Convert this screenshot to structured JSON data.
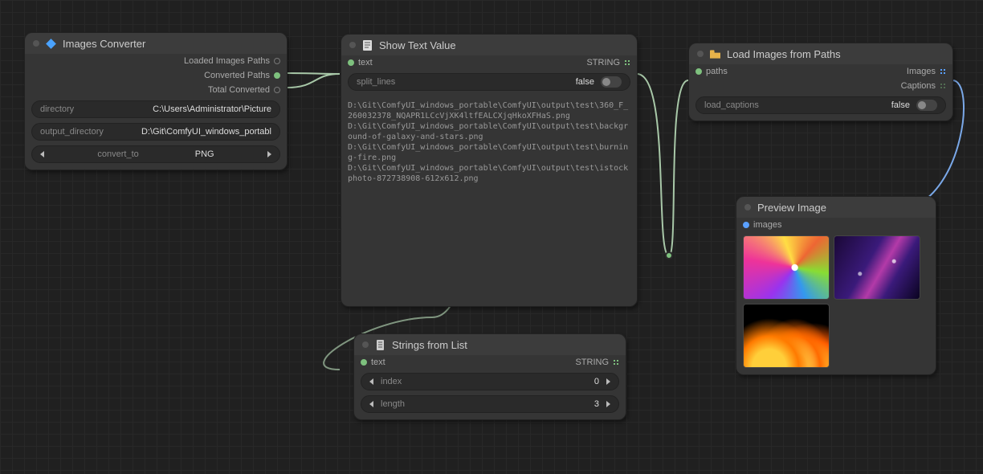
{
  "nodes": {
    "converter": {
      "title": "Images Converter",
      "outputs": {
        "loaded": "Loaded Images Paths",
        "converted": "Converted Paths",
        "total": "Total Converted"
      },
      "widgets": {
        "directory_label": "directory",
        "directory_value": "C:\\Users\\Administrator\\Picture",
        "output_dir_label": "output_directory",
        "output_dir_value": "D:\\Git\\ComfyUI_windows_portabl",
        "convert_to_label": "convert_to",
        "convert_to_value": "PNG"
      }
    },
    "showtext": {
      "title": "Show Text Value",
      "input": "text",
      "output_type": "STRING",
      "widgets": {
        "split_lines_label": "split_lines",
        "split_lines_value": "false"
      },
      "text_body": "D:\\Git\\ComfyUI_windows_portable\\ComfyUI\\output\\test\\360_F_260032378_NQAPR1LCcVjXK4ltfEALCXjqHkoXFHaS.png\nD:\\Git\\ComfyUI_windows_portable\\ComfyUI\\output\\test\\background-of-galaxy-and-stars.png\nD:\\Git\\ComfyUI_windows_portable\\ComfyUI\\output\\test\\burning-fire.png\nD:\\Git\\ComfyUI_windows_portable\\ComfyUI\\output\\test\\istockphoto-872738908-612x612.png"
    },
    "stringsfromlist": {
      "title": "Strings from List",
      "input": "text",
      "output_type": "STRING",
      "widgets": {
        "index_label": "index",
        "index_value": "0",
        "length_label": "length",
        "length_value": "3"
      }
    },
    "loadimages": {
      "title": "Load Images from Paths",
      "input": "paths",
      "outputs": {
        "images": "Images",
        "captions": "Captions"
      },
      "widgets": {
        "load_captions_label": "load_captions",
        "load_captions_value": "false"
      }
    },
    "preview": {
      "title": "Preview Image",
      "input": "images"
    }
  }
}
